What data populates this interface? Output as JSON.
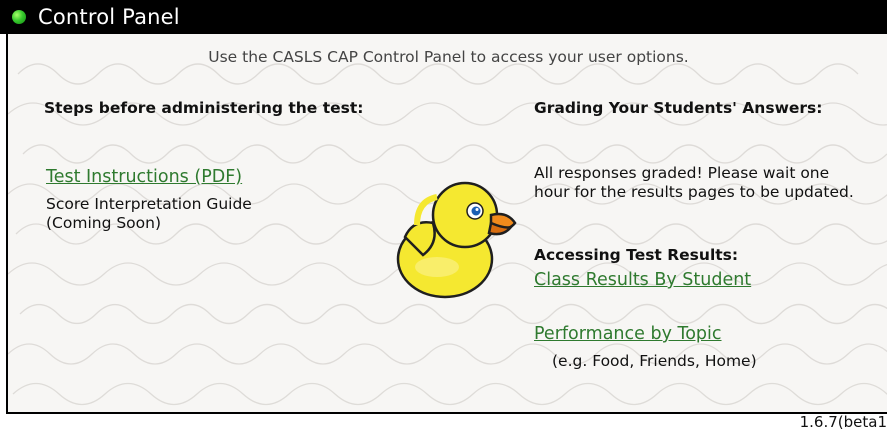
{
  "header": {
    "title": "Control Panel"
  },
  "intro": "Use the CASLS CAP Control Panel to access your user options.",
  "left": {
    "heading": "Steps before administering the test:",
    "test_instructions_link": "Test Instructions (PDF)",
    "score_guide_line1": "Score Interpretation Guide",
    "score_guide_line2": "(Coming Soon)"
  },
  "right": {
    "grading_heading": "Grading Your Students' Answers:",
    "grading_status": "All responses graded! Please wait one hour for the results pages to be updated.",
    "results_heading": "Accessing Test Results:",
    "class_results_link": "Class Results By Student",
    "performance_link": "Performance by Topic",
    "performance_hint": "(e.g. Food, Friends, Home)"
  },
  "footer": {
    "version": "1.6.7(beta1"
  },
  "colors": {
    "title_bar": "#000000",
    "link": "#2f7a2f",
    "status_dot": "#37c92d",
    "duck": "#f5e830"
  },
  "icons": {
    "status": "green-dot-icon",
    "mascot": "rubber-duck-icon"
  }
}
